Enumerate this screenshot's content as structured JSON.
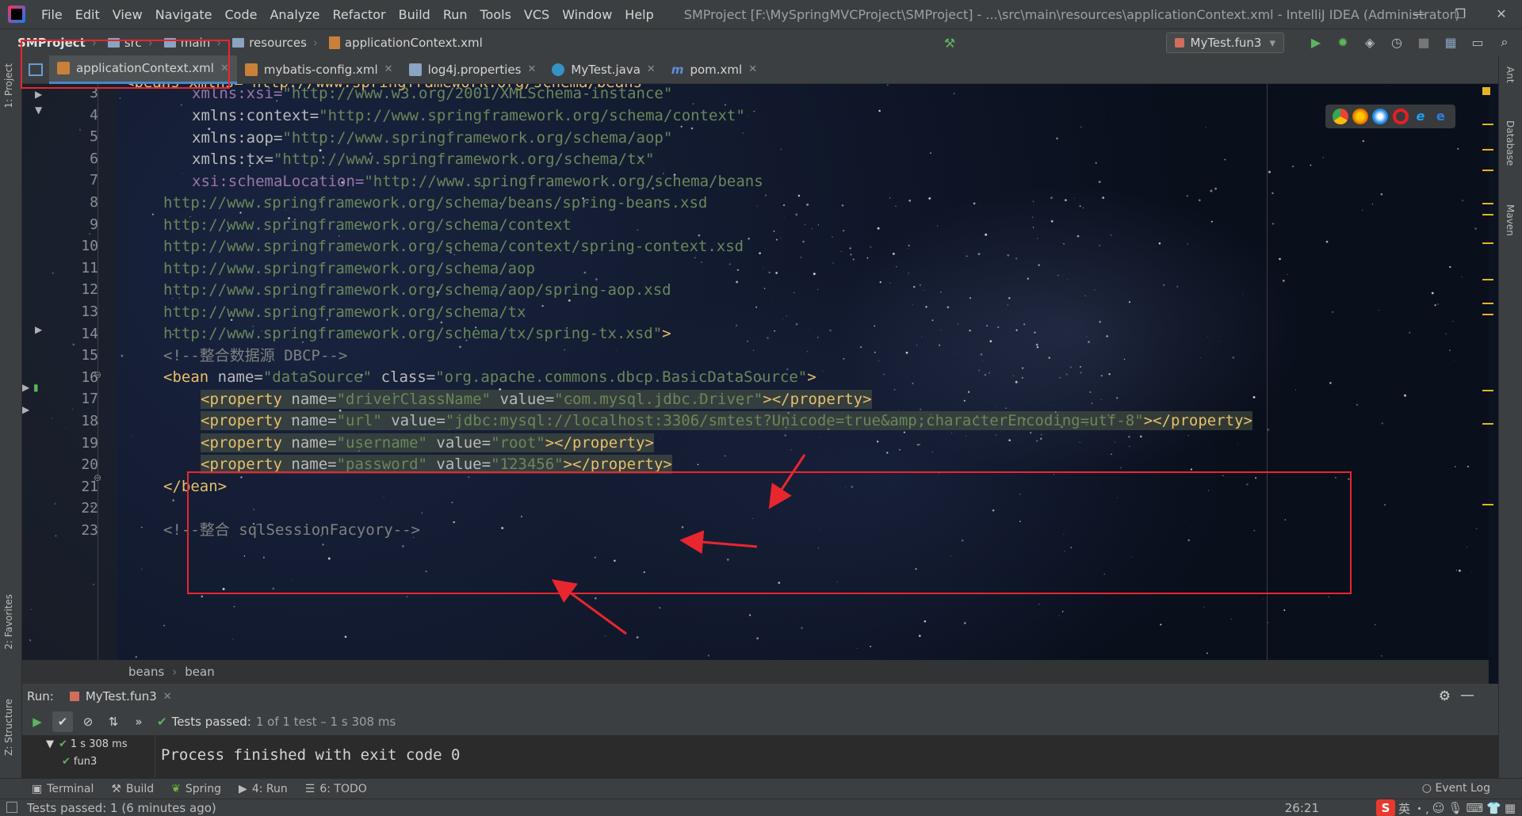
{
  "titlebar": {
    "menu": [
      "File",
      "Edit",
      "View",
      "Navigate",
      "Code",
      "Analyze",
      "Refactor",
      "Build",
      "Run",
      "Tools",
      "VCS",
      "Window",
      "Help"
    ],
    "title": "SMProject [F:\\MySpringMVCProject\\SMProject] - ...\\src\\main\\resources\\applicationContext.xml - IntelliJ IDEA (Administrator)",
    "minimize": "—",
    "restore": "❐",
    "close": "✕"
  },
  "navbar": {
    "project": "SMProject",
    "path": [
      "src",
      "main",
      "resources"
    ],
    "file": "applicationContext.xml",
    "run_config": "MyTest.fun3"
  },
  "tabs": [
    {
      "label": "applicationContext.xml",
      "active": true,
      "color": "#c9803a"
    },
    {
      "label": "mybatis-config.xml",
      "active": false,
      "color": "#c9803a"
    },
    {
      "label": "log4j.properties",
      "active": false,
      "color": "#8aa4c1"
    },
    {
      "label": "MyTest.java",
      "active": false,
      "color": "#3592c4"
    },
    {
      "label": "pom.xml",
      "active": false,
      "color": "#5c8fd6"
    }
  ],
  "left_tools": {
    "project": "1: Project",
    "favorites": "2: Favorites",
    "structure": "Z: Structure"
  },
  "right_tools": {
    "ant": "Ant",
    "database": "Database",
    "maven": "Maven"
  },
  "editor": {
    "line_numbers": [
      "3",
      "4",
      "5",
      "6",
      "7",
      "8",
      "9",
      "10",
      "11",
      "12",
      "13",
      "14",
      "15",
      "16",
      "17",
      "18",
      "19",
      "20",
      "21",
      "22",
      "23"
    ],
    "first_line": "<beans xmlns=\"http://www.springframework.org/schema/beans\"",
    "lines": {
      "l3": {
        "attr": "xmlns:xsi=",
        "val": "\"http://www.w3.org/2001/XMLSchema-instance\""
      },
      "l4": {
        "attr": "xmlns:context=",
        "val": "\"http://www.springframework.org/schema/context\""
      },
      "l5": {
        "attr": "xmlns:aop=",
        "val": "\"http://www.springframework.org/schema/aop\""
      },
      "l6": {
        "attr": "xmlns:tx=",
        "val": "\"http://www.springframework.org/schema/tx\""
      },
      "l7": {
        "attr": "xsi:schemaLocation=",
        "val": "\"http://www.springframework.org/schema/beans"
      },
      "l8": "http://www.springframework.org/schema/beans/spring-beans.xsd",
      "l9": "http://www.springframework.org/schema/context",
      "l10": "http://www.springframework.org/schema/context/spring-context.xsd",
      "l11": "http://www.springframework.org/schema/aop",
      "l12": "http://www.springframework.org/schema/aop/spring-aop.xsd",
      "l13": "http://www.springframework.org/schema/tx",
      "l14": "http://www.springframework.org/schema/tx/spring-tx.xsd\"",
      "l14_close": ">",
      "l15": "<!--整合数据源 DBCP-->",
      "l16_open": "<bean ",
      "l16_name_attr": "name=",
      "l16_name_val": "\"dataSource\"",
      "l16_class_attr": " class=",
      "l16_class_val": "\"org.apache.commons.dbcp.BasicDataSource\"",
      "l16_close": ">",
      "properties": [
        {
          "name": "\"driverClassName\"",
          "value": "\"com.mysql.jdbc.Driver\""
        },
        {
          "name": "\"url\"",
          "value": "\"jdbc:mysql://localhost:3306/smtest?Unicode=true&amp;characterEncoding=utf-8\""
        },
        {
          "name": "\"username\"",
          "value": "\"root\""
        },
        {
          "name": "\"password\"",
          "value": "\"123456\""
        }
      ],
      "prop_open": "<property ",
      "prop_name_attr": "name=",
      "prop_value_attr": " value=",
      "prop_close": "></property>",
      "l21": "</bean>",
      "l23": "<!--整合 sqlSessionFacyory-->"
    }
  },
  "editor_breadcrumbs": [
    "beans",
    "bean"
  ],
  "run": {
    "label": "Run:",
    "tab": "MyTest.fun3",
    "status_passed": "Tests passed:",
    "status_detail": "1 of 1 test – 1 s 308 ms",
    "tree_root": "1 s 308 ms",
    "tree_child": "fun3",
    "console": "Process finished with exit code 0"
  },
  "tool_tabs": [
    "Terminal",
    "Build",
    "Spring",
    "4: Run",
    "6: TODO"
  ],
  "event_log": "Event Log",
  "statusbar": {
    "message": "Tests passed: 1 (6 minutes ago)",
    "position": "26:21",
    "ime_label": "英"
  },
  "colors": {
    "accent": "#4a88c7",
    "highlight_box": "#e8262e",
    "tag": "#e8bf6a",
    "string": "#6a8759"
  }
}
